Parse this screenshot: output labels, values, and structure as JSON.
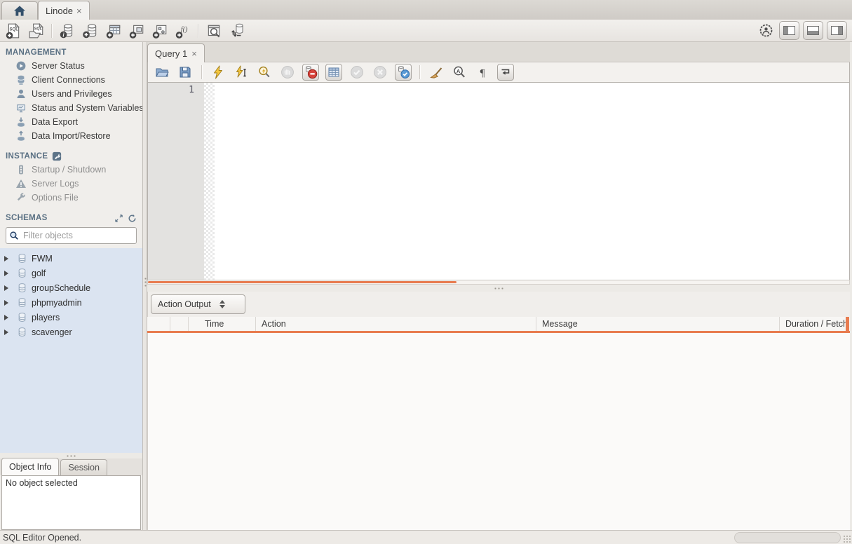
{
  "window": {
    "active_tab_label": "Linode",
    "close_glyph": "×"
  },
  "sidebar": {
    "management": {
      "title": "MANAGEMENT",
      "items": [
        "Server Status",
        "Client Connections",
        "Users and Privileges",
        "Status and System Variables",
        "Data Export",
        "Data Import/Restore"
      ]
    },
    "instance": {
      "title": "INSTANCE",
      "items": [
        "Startup / Shutdown",
        "Server Logs",
        "Options File"
      ]
    },
    "schemas": {
      "title": "SCHEMAS",
      "filter_placeholder": "Filter objects",
      "items": [
        "FWM",
        "golf",
        "groupSchedule",
        "phpmyadmin",
        "players",
        "scavenger"
      ]
    },
    "info": {
      "tabs": [
        "Object Info",
        "Session"
      ],
      "content": "No object selected"
    }
  },
  "editor": {
    "tab_label": "Query 1",
    "close_glyph": "×",
    "first_line_number": "1"
  },
  "output": {
    "selector_label": "Action Output",
    "columns": {
      "time": "Time",
      "action": "Action",
      "message": "Message",
      "duration": "Duration / Fetch"
    }
  },
  "statusbar": {
    "text": "SQL Editor Opened."
  },
  "colors": {
    "accent_orange": "#E87C50",
    "schema_panel_blue": "#DBE4F1",
    "section_header_blue": "#5A7083"
  }
}
